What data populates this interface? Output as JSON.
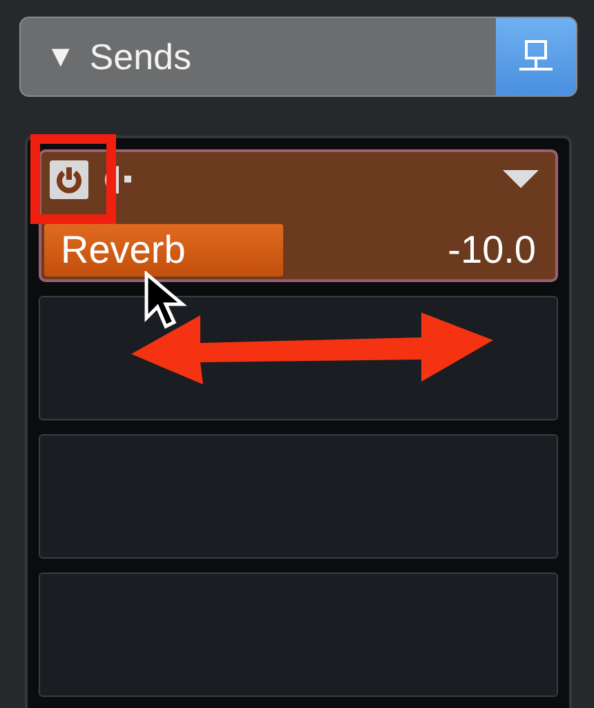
{
  "header": {
    "toggle": "▼",
    "title": "Sends",
    "expanded": true
  },
  "slots": [
    {
      "kind": "send",
      "on": true,
      "name": "Reverb",
      "value": "-10.0",
      "level": 0.47
    },
    {
      "kind": "empty"
    },
    {
      "kind": "empty"
    },
    {
      "kind": "empty"
    }
  ]
}
